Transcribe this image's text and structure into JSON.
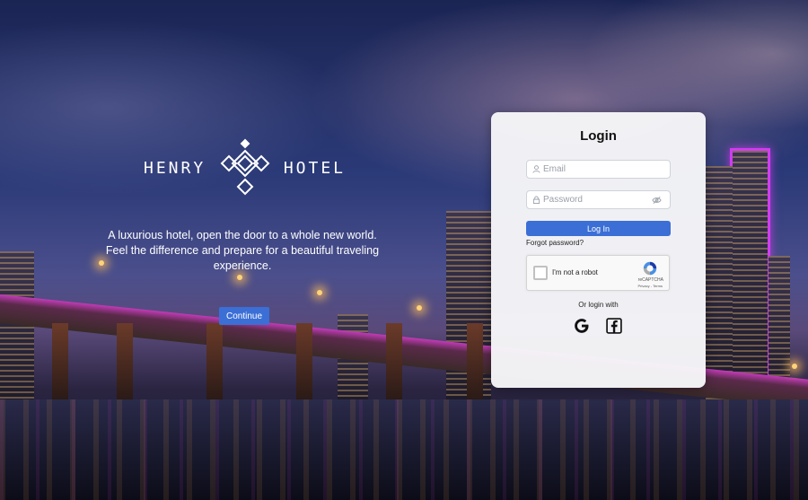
{
  "brand": {
    "word_left": "HENRY",
    "word_right": "HOTEL"
  },
  "hero": {
    "tagline": "A luxurious hotel, open the door to a whole new world. Feel the difference and prepare for a beautiful traveling experience.",
    "continue_label": "Continue"
  },
  "login": {
    "title": "Login",
    "email_placeholder": "Email",
    "password_placeholder": "Password",
    "login_button": "Log In",
    "forgot_password": "Forgot password?",
    "captcha": {
      "label": "I'm not a robot",
      "brand": "reCAPTCHA",
      "links": "Privacy - Terms"
    },
    "or_login_with": "Or login with",
    "social": [
      "google-icon",
      "facebook-icon"
    ]
  },
  "colors": {
    "accent": "#3b6fd6",
    "card_bg": "#f6f6f8"
  }
}
